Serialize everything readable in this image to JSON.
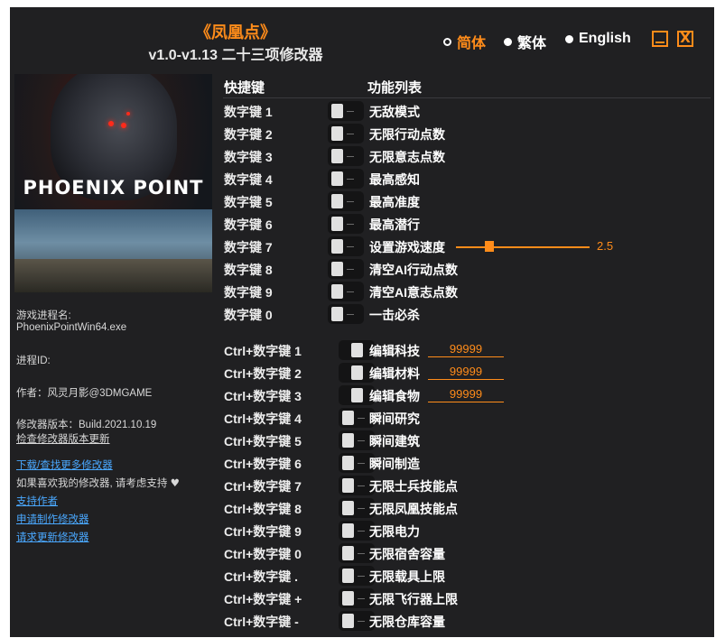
{
  "header": {
    "title": "《凤凰点》",
    "subtitle": "v1.0-v1.13 二十三项修改器"
  },
  "languages": [
    {
      "label": "简体",
      "selected": true
    },
    {
      "label": "繁体",
      "selected": false
    },
    {
      "label": "English",
      "selected": false
    }
  ],
  "window_buttons": {
    "minimize_icon": "minimize-icon",
    "close_symbol": "X"
  },
  "cover": {
    "title": "PHOENIX POINT"
  },
  "info": {
    "process_label": "游戏进程名:",
    "process_name": "PhoenixPointWin64.exe",
    "pid_label": "进程ID:",
    "author": "作者：风灵月影@3DMGAME",
    "version": "修改器版本：Build.2021.10.19",
    "check_update": "检查修改器版本更新",
    "download_more": "下载/查找更多修改器",
    "support_text": "如果喜欢我的修改器, 请考虑支持",
    "heart": "♥",
    "support_author": "支持作者",
    "request_make": "申请制作修改器",
    "request_update": "请求更新修改器"
  },
  "table": {
    "col_hotkey": "快捷键",
    "col_function": "功能列表",
    "rows": [
      {
        "hotkey": "数字键 1",
        "label": "无敌模式"
      },
      {
        "hotkey": "数字键 2",
        "label": "无限行动点数"
      },
      {
        "hotkey": "数字键 3",
        "label": "无限意志点数"
      },
      {
        "hotkey": "数字键 4",
        "label": "最高感知"
      },
      {
        "hotkey": "数字键 5",
        "label": "最高准度"
      },
      {
        "hotkey": "数字键 6",
        "label": "最高潜行"
      },
      {
        "hotkey": "数字键 7",
        "label": "设置游戏速度",
        "slider_value": "2.5"
      },
      {
        "hotkey": "数字键 8",
        "label": "清空AI行动点数"
      },
      {
        "hotkey": "数字键 9",
        "label": "清空AI意志点数"
      },
      {
        "hotkey": "数字键 0",
        "label": "一击必杀"
      },
      {
        "hotkey": "Ctrl+数字键 1",
        "label": "编辑科技",
        "input": "99999"
      },
      {
        "hotkey": "Ctrl+数字键 2",
        "label": "编辑材料",
        "input": "99999"
      },
      {
        "hotkey": "Ctrl+数字键 3",
        "label": "编辑食物",
        "input": "99999"
      },
      {
        "hotkey": "Ctrl+数字键 4",
        "label": "瞬间研究"
      },
      {
        "hotkey": "Ctrl+数字键 5",
        "label": "瞬间建筑"
      },
      {
        "hotkey": "Ctrl+数字键 6",
        "label": "瞬间制造"
      },
      {
        "hotkey": "Ctrl+数字键 7",
        "label": "无限士兵技能点"
      },
      {
        "hotkey": "Ctrl+数字键 8",
        "label": "无限凤凰技能点"
      },
      {
        "hotkey": "Ctrl+数字键 9",
        "label": "无限电力"
      },
      {
        "hotkey": "Ctrl+数字键 0",
        "label": "无限宿舍容量"
      },
      {
        "hotkey": "Ctrl+数字键 .",
        "label": "无限载具上限"
      },
      {
        "hotkey": "Ctrl+数字键 +",
        "label": "无限飞行器上限"
      },
      {
        "hotkey": "Ctrl+数字键 -",
        "label": "无限仓库容量"
      }
    ]
  },
  "slider": {
    "min": 0,
    "max": 10,
    "value": 2.5
  },
  "colors": {
    "accent": "#ff8c1a",
    "background": "#202022",
    "link": "#4aa8ff"
  }
}
